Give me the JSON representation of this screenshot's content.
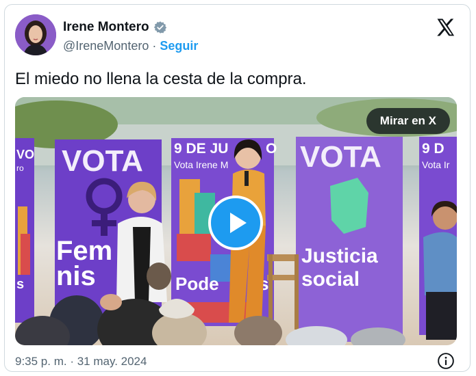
{
  "tweet": {
    "author_name": "Irene Montero",
    "author_handle": "@IreneMontero",
    "separator": "·",
    "follow_label": "Seguir",
    "text": "El miedo no llena la cesta de la compra.",
    "timestamp": "9:35 p. m. · 31 may. 2024"
  },
  "media": {
    "watch_label": "Mirar en X",
    "banner_left_vote": "VOTA",
    "banner_left_fem": "Fem",
    "banner_left_nis": "nis",
    "banner_center_date": "9 DE JU",
    "banner_center_date_end": "O",
    "banner_center_vote": "Vota Irene M",
    "banner_center_podem": "Pode",
    "banner_center_podem_end": "s",
    "banner_right_vote": "VOTA",
    "banner_right_justicia": "Justicia",
    "banner_right_social": "social",
    "banner_far_right_date": "9 D",
    "banner_far_right_vote": "Vota Ir",
    "banner_far_left_vote": "VO",
    "banner_far_left_ro": "ro",
    "banner_far_left_s": "s"
  },
  "icons": {
    "verified": "verified-badge-icon",
    "x_logo": "x-logo-icon",
    "play": "play-icon",
    "info": "info-icon"
  },
  "colors": {
    "accent": "#1d9bf0",
    "banner_purple": "#6d3fc8",
    "banner_purple_light": "#8d62d6"
  }
}
